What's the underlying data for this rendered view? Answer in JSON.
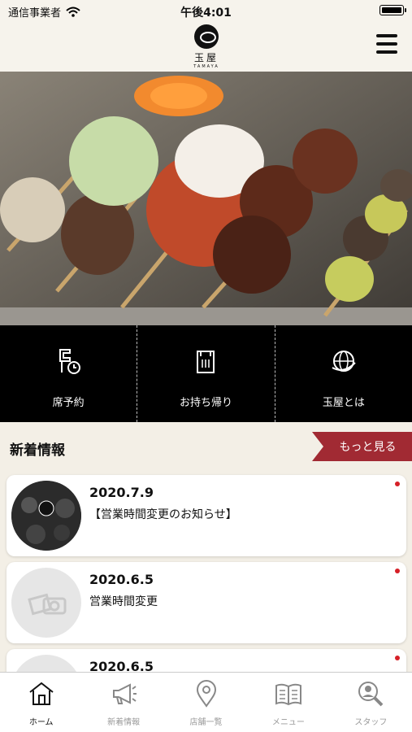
{
  "status_bar": {
    "carrier": "通信事業者",
    "time": "午後4:01"
  },
  "header": {
    "logo_text": "玉屋",
    "logo_sub": "TAMAYA"
  },
  "actions": [
    {
      "label": "席予約",
      "icon": "reservation-icon"
    },
    {
      "label": "お持ち帰り",
      "icon": "takeout-bag-icon"
    },
    {
      "label": "玉屋とは",
      "icon": "globe-icon"
    }
  ],
  "news": {
    "title": "新着情報",
    "more_label": "もっと見る",
    "items": [
      {
        "date": "2020.7.9",
        "text": "【営業時間変更のお知らせ】",
        "thumb": "logo-thumbnail"
      },
      {
        "date": "2020.6.5",
        "text": "営業時間変更",
        "thumb": "placeholder-photo-icon"
      },
      {
        "date": "2020.6.5",
        "text": "",
        "thumb": "placeholder-photo-icon"
      }
    ]
  },
  "tabbar": [
    {
      "label": "ホーム",
      "icon": "home-icon",
      "active": true
    },
    {
      "label": "新着情報",
      "icon": "megaphone-icon",
      "active": false
    },
    {
      "label": "店舗一覧",
      "icon": "map-pin-icon",
      "active": false
    },
    {
      "label": "メニュー",
      "icon": "menu-book-icon",
      "active": false
    },
    {
      "label": "スタッフ",
      "icon": "staff-search-icon",
      "active": false
    }
  ],
  "colors": {
    "accent": "#a12a33",
    "unread_dot": "#d62027",
    "background": "#f3efe6"
  }
}
